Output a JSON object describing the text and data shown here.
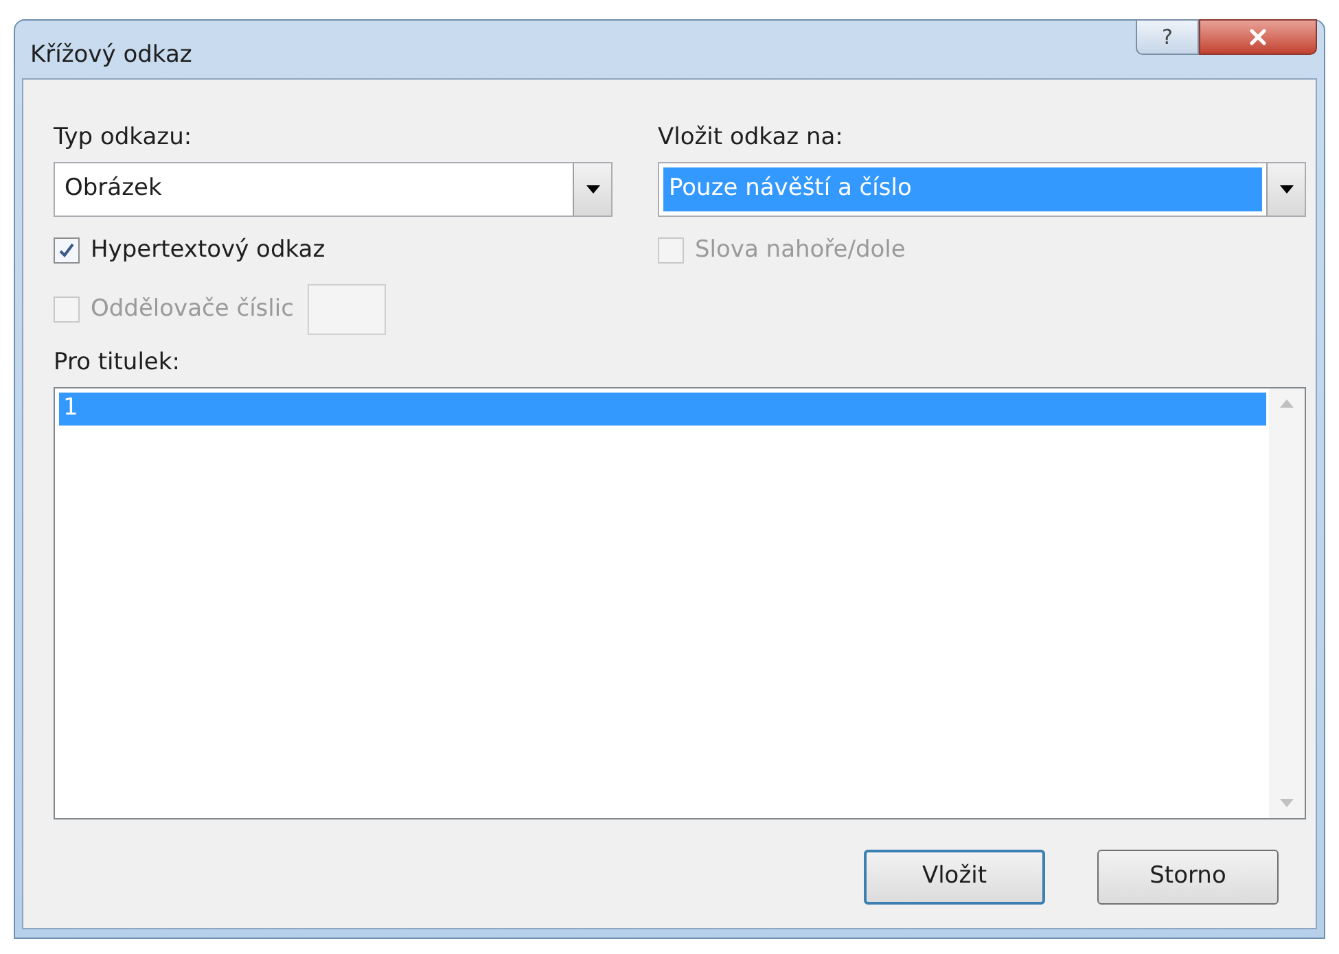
{
  "window": {
    "title": "Křížový odkaz",
    "help_button": "?"
  },
  "reference_type": {
    "label": "Typ odkazu:",
    "value": "Obrázek"
  },
  "insert_reference_to": {
    "label": "Vložit odkaz na:",
    "value": "Pouze návěští a číslo",
    "selected": true
  },
  "checkboxes": [
    {
      "label": "Hypertextový odkaz",
      "checked": true,
      "disabled": false
    },
    {
      "label": "Oddělovače číslic",
      "checked": false,
      "disabled": true
    }
  ],
  "above_below": {
    "label": "Slova nahoře/dole",
    "checked": false,
    "disabled": true
  },
  "caption_list": {
    "label": "Pro titulek:",
    "items": [
      {
        "text": "1",
        "selected": true
      }
    ]
  },
  "buttons": [
    {
      "label": "Vložit",
      "default": true
    },
    {
      "label": "Storno",
      "default": false
    }
  ]
}
